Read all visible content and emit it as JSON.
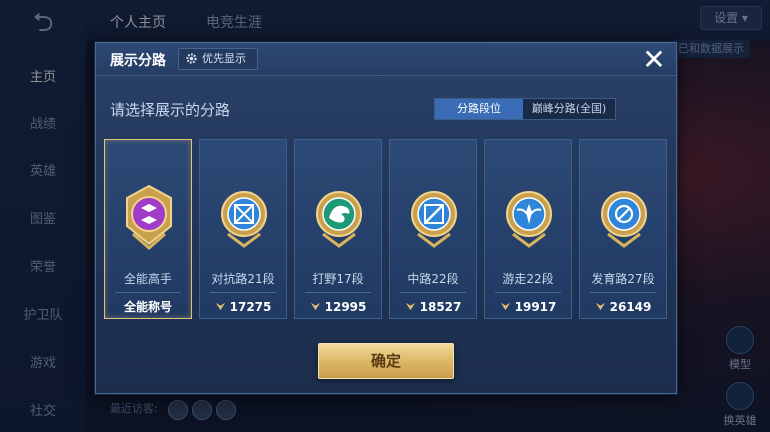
{
  "background": {
    "sidebar_items": [
      "主页",
      "战绩",
      "英雄",
      "图鉴",
      "荣誉",
      "护卫队",
      "游戏",
      "社交"
    ],
    "top_tabs": [
      "个人主页",
      "电竞生涯"
    ],
    "settings_label": "设置",
    "right_panel_label": "已和数据展示",
    "right_buttons": [
      "模型",
      "换英雄"
    ],
    "recent_visitors_label": "最近访客:"
  },
  "dialog": {
    "title": "展示分路",
    "priority_button": "优先显示",
    "subtitle": "请选择展示的分路",
    "tabs": [
      {
        "label": "分路段位",
        "active": true
      },
      {
        "label": "巅峰分路(全国)",
        "active": false
      }
    ],
    "cards": [
      {
        "name": "全能高手",
        "footer": "全能称号",
        "score": null,
        "selected": true,
        "emblem": "all-round-emblem-icon",
        "color": "#a03cc8"
      },
      {
        "name": "对抗路21段",
        "footer": "17275",
        "score": 17275,
        "selected": false,
        "emblem": "clash-lane-emblem-icon",
        "color": "#2f86d8"
      },
      {
        "name": "打野17段",
        "footer": "12995",
        "score": 12995,
        "selected": false,
        "emblem": "jungle-emblem-icon",
        "color": "#1f9a78"
      },
      {
        "name": "中路22段",
        "footer": "18527",
        "score": 18527,
        "selected": false,
        "emblem": "mid-lane-emblem-icon",
        "color": "#2f86d8"
      },
      {
        "name": "游走22段",
        "footer": "19917",
        "score": 19917,
        "selected": false,
        "emblem": "roam-emblem-icon",
        "color": "#2f86d8"
      },
      {
        "name": "发育路27段",
        "footer": "26149",
        "score": 26149,
        "selected": false,
        "emblem": "farm-lane-emblem-icon",
        "color": "#2f86d8"
      }
    ],
    "confirm_button": "确定"
  }
}
